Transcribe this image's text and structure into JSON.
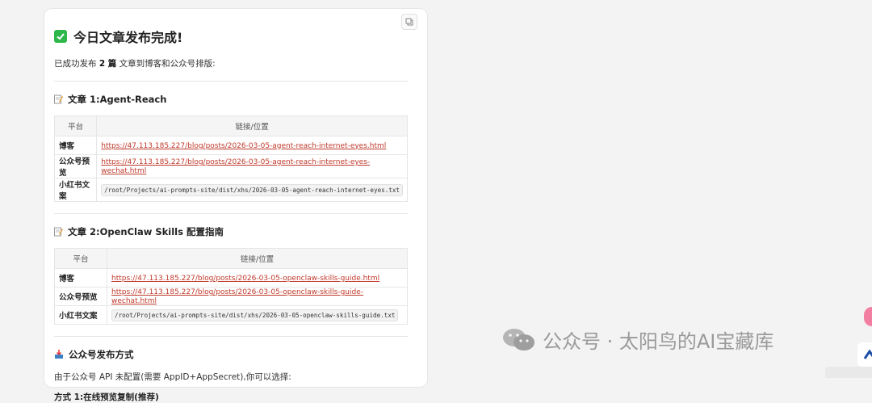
{
  "header": {
    "title": "今日文章发布完成!",
    "intro_prefix": "已成功发布 ",
    "intro_count": "2 篇",
    "intro_suffix": " 文章到博客和公众号排版:"
  },
  "articles": [
    {
      "heading": "文章 1:Agent-Reach",
      "columns": [
        "平台",
        "链接/位置"
      ],
      "rows": [
        {
          "platform": "博客",
          "value": "https://47.113.185.227/blog/posts/2026-03-05-agent-reach-internet-eyes.html"
        },
        {
          "platform": "公众号预览",
          "value": "https://47.113.185.227/blog/posts/2026-03-05-agent-reach-internet-eyes-wechat.html"
        },
        {
          "platform": "小红书文案",
          "value": "/root/Projects/ai-prompts-site/dist/xhs/2026-03-05-agent-reach-internet-eyes.txt"
        }
      ]
    },
    {
      "heading": "文章 2:OpenClaw Skills 配置指南",
      "columns": [
        "平台",
        "链接/位置"
      ],
      "rows": [
        {
          "platform": "博客",
          "value": "https://47.113.185.227/blog/posts/2026-03-05-openclaw-skills-guide.html"
        },
        {
          "platform": "公众号预览",
          "value": "https://47.113.185.227/blog/posts/2026-03-05-openclaw-skills-guide-wechat.html"
        },
        {
          "platform": "小红书文案",
          "value": "/root/Projects/ai-prompts-site/dist/xhs/2026-03-05-openclaw-skills-guide.txt"
        }
      ]
    }
  ],
  "publish": {
    "heading": "公众号发布方式",
    "description": "由于公众号 API 未配置(需要 AppID+AppSecret),你可以选择:",
    "method1": "方式 1:在线预览复制(推荐)"
  },
  "watermark": {
    "text": "公众号 · 太阳鸟的AI宝藏库"
  },
  "icons": {
    "title_icon": "check-mark-icon",
    "article_icon": "memo-icon",
    "publish_icon": "inbox-tray-icon",
    "copy": "copy-icon",
    "wechat": "wechat-icon"
  },
  "colors": {
    "link": "#c0392b",
    "check_green": "#2eb84b"
  }
}
